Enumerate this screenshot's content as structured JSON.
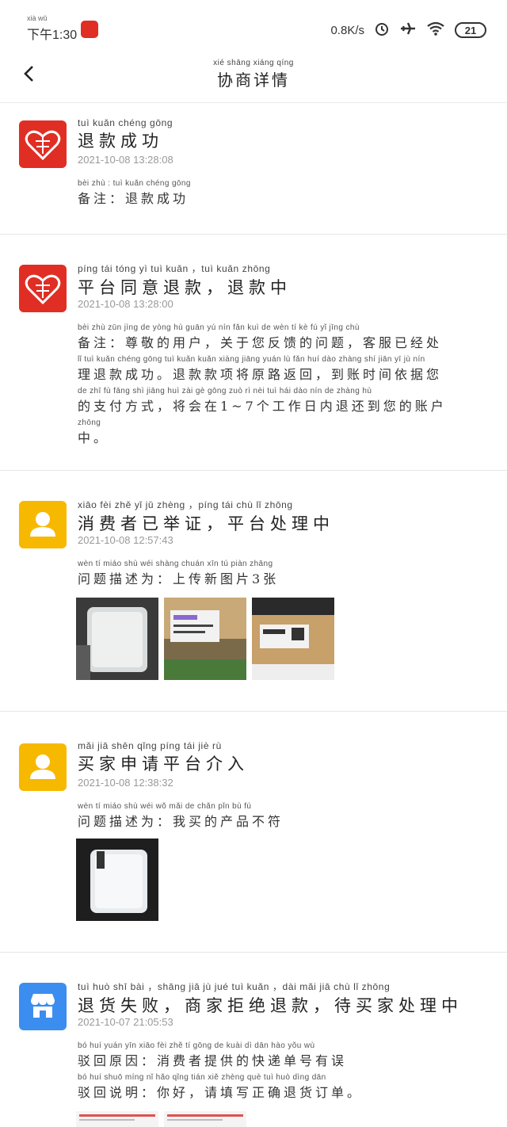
{
  "status_bar": {
    "time_pinyin": "xià wǔ",
    "time": "下午1:30",
    "speed": "0.8K/s",
    "battery": "21",
    "icons": [
      "app-icon",
      "alarm-icon",
      "airplane-icon",
      "wifi-icon",
      "battery-icon"
    ]
  },
  "header": {
    "back_icon": "chevron-left-icon",
    "title_pinyin": "xié shāng xiáng qíng",
    "title": "协商详情"
  },
  "events": [
    {
      "avatar": "pinduoduo-logo",
      "title_pinyin": "tuì kuǎn chéng gōng",
      "title": "退款成功",
      "time": "2021-10-08 13:28:08",
      "lines": [
        {
          "pinyin": "bèi zhù :  tuì kuǎn chéng gōng",
          "text": "备注：退款成功"
        }
      ]
    },
    {
      "avatar": "pinduoduo-logo",
      "title_pinyin": "píng tái tóng yì tuì kuǎn ，tuì kuǎn zhōng",
      "title": "平台同意退款，退款中",
      "time": "2021-10-08 13:28:00",
      "lines": [
        {
          "pinyin": "bèi zhù  zūn jìng de yòng hù   guān yú nín fǎn kuì de wèn tí    kè fú yǐ jīng chù",
          "text": "备注：尊敬的用户，关于您反馈的问题，客服已经处"
        },
        {
          "pinyin": "lǐ tuì kuǎn chéng gōng   tuì kuǎn kuǎn xiàng jiāng yuán lù fǎn huí   dào zhàng shí jiān yī jù nín",
          "text": "理退款成功。退款款项将原路返回，到账时间依据您"
        },
        {
          "pinyin": "de zhī fù fāng shì    jiāng huì zài   gè gōng zuò rì nèi tuì hái dào nín de zhàng hù",
          "text": "的支付方式，将会在1~7个工作日内退还到您的账户"
        },
        {
          "pinyin": "zhōng",
          "text": "中。"
        }
      ]
    },
    {
      "avatar": "user-icon",
      "title_pinyin": "xiāo fèi zhě yǐ jǔ zhèng ，píng tái chù lǐ zhōng",
      "title": "消费者已举证，平台处理中",
      "time": "2021-10-08 12:57:43",
      "lines": [
        {
          "pinyin": "wèn tí miáo shù wéi   shàng chuán xīn tú piàn  zhāng",
          "text": "问题描述为：上传新图片3张"
        }
      ],
      "images": [
        "product-photo",
        "shipping-label-photo",
        "parcel-photo"
      ]
    },
    {
      "avatar": "user-icon",
      "title_pinyin": "mǎi jiā shēn qǐng píng tái jiè rù",
      "title": "买家申请平台介入",
      "time": "2021-10-08 12:38:32",
      "lines": [
        {
          "pinyin": "wèn tí miáo shù wéi   wǒ mǎi de chǎn pǐn bù fú",
          "text": "问题描述为：我买的产品不符"
        }
      ],
      "images": [
        "product-photo"
      ]
    },
    {
      "avatar": "store-icon",
      "title_pinyin": "tuì huò shī bài ，shāng jiā jù jué tuì kuǎn ，dài mǎi jiā chù lǐ zhōng",
      "title": "退货失败，商家拒绝退款，待买家处理中",
      "time": "2021-10-07 21:05:53",
      "lines": [
        {
          "pinyin": "bó huí yuán yīn   xiāo fèi zhě tí gōng de kuài dì dān hào yǒu wù",
          "text": "驳回原因：消费者提供的快递单号有误"
        },
        {
          "pinyin": "bó huí shuō míng   nǐ hǎo    qǐng tián xiě zhèng què tuì huò dìng dān",
          "text": "驳回说明：你好，请填写正确退货订单。"
        }
      ]
    }
  ],
  "colors": {
    "pdd_red": "#e02e24",
    "user_yellow": "#f7b800",
    "store_blue": "#3b8ef0"
  }
}
